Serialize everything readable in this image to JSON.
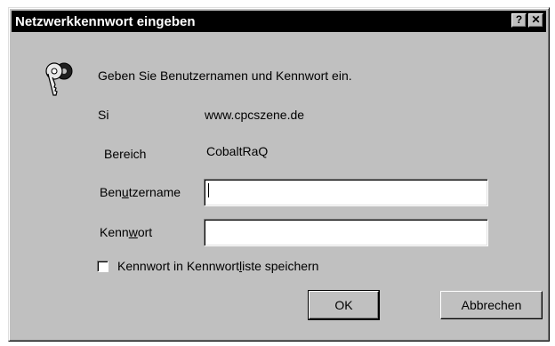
{
  "dialog": {
    "title": "Netzwerkkennwort eingeben",
    "help_label": "?",
    "close_label": "✕",
    "prompt": "Geben Sie Benutzernamen und Kennwort ein.",
    "site_label": "Si",
    "site_value": "www.cpcszene.de",
    "realm_label": "Bereich",
    "realm_value": "CobaltRaQ",
    "username_label_pre": "Ben",
    "username_label_ul": "u",
    "username_label_post": "tzername",
    "username_value": "",
    "password_label_pre": "Kenn",
    "password_label_ul": "w",
    "password_label_post": "ort",
    "password_value": "",
    "save_label_pre": "Kennwort in Kennwort",
    "save_label_ul": "l",
    "save_label_post": "iste speichern",
    "save_checked": false,
    "ok_label": "OK",
    "cancel_label": "Abbrechen",
    "icon": "keys-icon"
  }
}
